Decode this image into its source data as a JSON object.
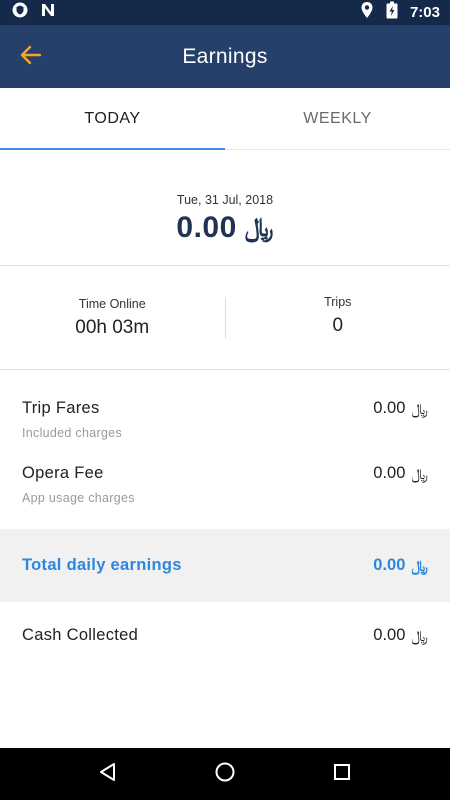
{
  "status_bar": {
    "time": "7:03"
  },
  "app_bar": {
    "title": "Earnings"
  },
  "tabs": [
    {
      "label": "TODAY",
      "active": true
    },
    {
      "label": "WEEKLY",
      "active": false
    }
  ],
  "summary": {
    "date": "Tue, 31 Jul, 2018",
    "amount": "0.00",
    "currency": "﷼"
  },
  "stats": {
    "time_online": {
      "label": "Time Online",
      "value": "00h 03m"
    },
    "trips": {
      "label": "Trips",
      "value": "0"
    }
  },
  "breakdown": [
    {
      "title": "Trip Fares",
      "subtitle": "Included charges",
      "amount": "0.00",
      "currency": "﷼"
    },
    {
      "title": "Opera Fee",
      "subtitle": "App usage charges",
      "amount": "0.00",
      "currency": "﷼"
    }
  ],
  "total": {
    "label": "Total daily earnings",
    "amount": "0.00",
    "currency": "﷼"
  },
  "cash": {
    "label": "Cash Collected",
    "amount": "0.00",
    "currency": "﷼"
  },
  "colors": {
    "status_bar": "#15294a",
    "app_bar": "#24406b",
    "accent": "#f5a623",
    "tab_indicator": "#3a8ee6",
    "total": "#2d87df",
    "amount_dark": "#1f3354"
  },
  "icons": {
    "status_left": [
      "shield-icon",
      "n-notification-icon"
    ],
    "status_right": [
      "location-icon",
      "battery-icon"
    ],
    "back": "arrow-left-icon",
    "nav": [
      "back-triangle-icon",
      "home-circle-icon",
      "recents-square-icon"
    ]
  }
}
